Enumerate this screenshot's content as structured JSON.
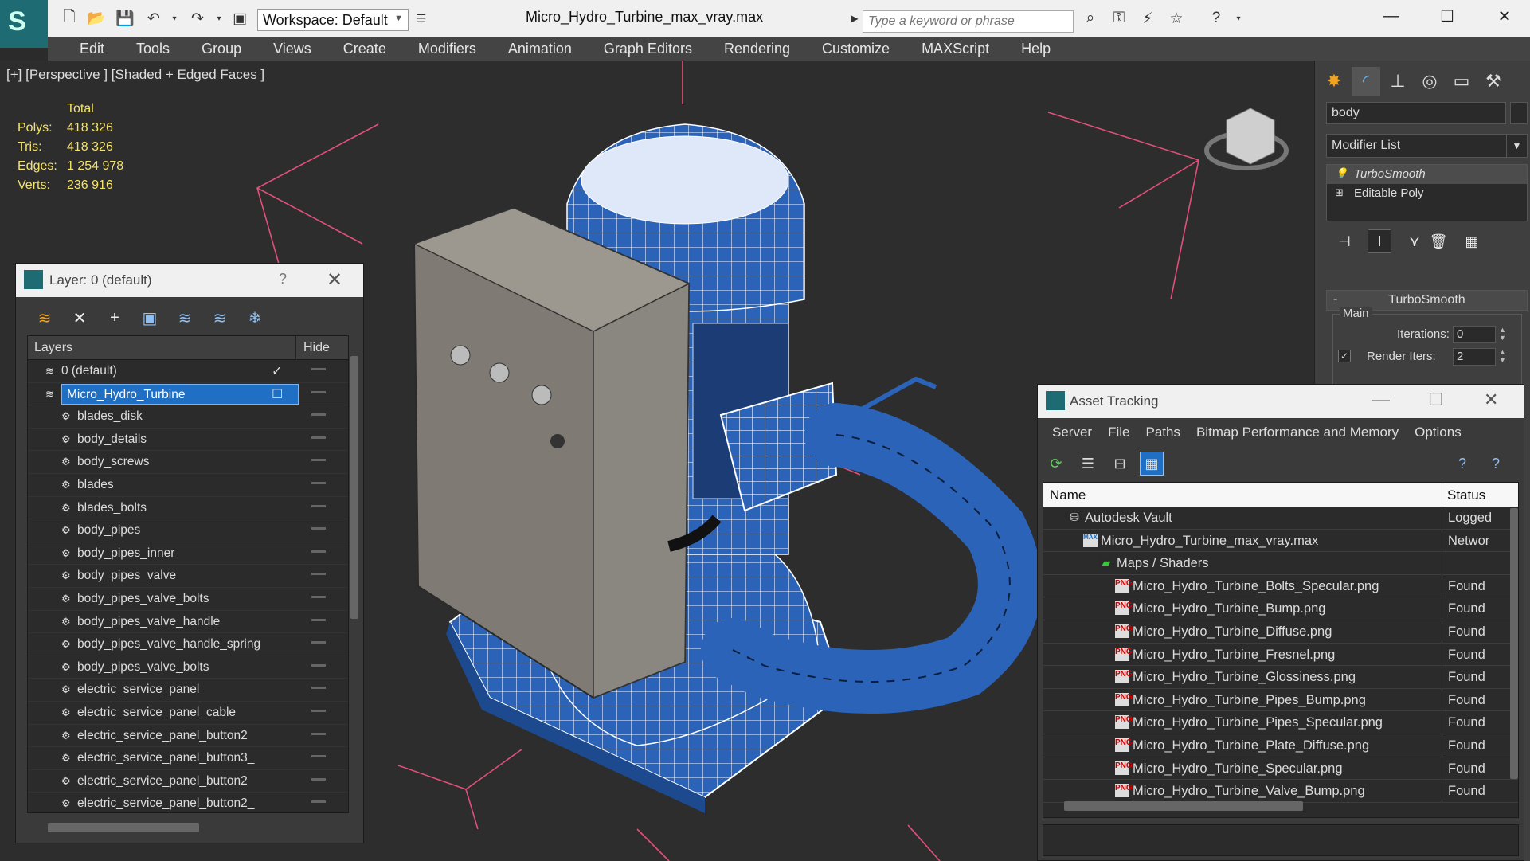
{
  "app": {
    "title": "Micro_Hydro_Turbine_max_vray.max",
    "workspace_label": "Workspace: Default",
    "search_placeholder": "Type a keyword or phrase"
  },
  "menu": [
    "Edit",
    "Tools",
    "Group",
    "Views",
    "Create",
    "Modifiers",
    "Animation",
    "Graph Editors",
    "Rendering",
    "Customize",
    "MAXScript",
    "Help"
  ],
  "viewport": {
    "label": "[+] [Perspective ] [Shaded + Edged Faces ]",
    "stats": {
      "header": "Total",
      "rows": [
        {
          "k": "Polys:",
          "v": "418 326"
        },
        {
          "k": "Tris:",
          "v": "418 326"
        },
        {
          "k": "Edges:",
          "v": "1 254 978"
        },
        {
          "k": "Verts:",
          "v": "236 916"
        }
      ]
    }
  },
  "command_panel": {
    "object_name": "body",
    "modifier_list": "Modifier List",
    "stack": [
      "TurboSmooth",
      "Editable Poly"
    ],
    "rollout_title": "TurboSmooth",
    "group_label": "Main",
    "iterations_label": "Iterations:",
    "iterations": "0",
    "render_iters_label": "Render Iters:",
    "render_iters": "2"
  },
  "layer_dialog": {
    "title": "Layer: 0 (default)",
    "help": "?",
    "col_layers": "Layers",
    "col_hide": "Hide",
    "rows": [
      {
        "name": "0 (default)",
        "level": 0,
        "type": "layer",
        "check": "✓"
      },
      {
        "name": "Micro_Hydro_Turbine",
        "level": 0,
        "type": "layer",
        "selected": true
      },
      {
        "name": "blades_disk",
        "level": 1,
        "type": "object"
      },
      {
        "name": "body_details",
        "level": 1,
        "type": "object"
      },
      {
        "name": "body_screws",
        "level": 1,
        "type": "object"
      },
      {
        "name": "blades",
        "level": 1,
        "type": "object"
      },
      {
        "name": "blades_bolts",
        "level": 1,
        "type": "object"
      },
      {
        "name": "body_pipes",
        "level": 1,
        "type": "object"
      },
      {
        "name": "body_pipes_inner",
        "level": 1,
        "type": "object"
      },
      {
        "name": "body_pipes_valve",
        "level": 1,
        "type": "object"
      },
      {
        "name": "body_pipes_valve_bolts",
        "level": 1,
        "type": "object"
      },
      {
        "name": "body_pipes_valve_handle",
        "level": 1,
        "type": "object"
      },
      {
        "name": "body_pipes_valve_handle_spring",
        "level": 1,
        "type": "object"
      },
      {
        "name": "body_pipes_valve_bolts",
        "level": 1,
        "type": "object"
      },
      {
        "name": "electric_service_panel",
        "level": 1,
        "type": "object"
      },
      {
        "name": "electric_service_panel_cable",
        "level": 1,
        "type": "object"
      },
      {
        "name": "electric_service_panel_button2",
        "level": 1,
        "type": "object"
      },
      {
        "name": "electric_service_panel_button3_",
        "level": 1,
        "type": "object"
      },
      {
        "name": "electric_service_panel_button2",
        "level": 1,
        "type": "object"
      },
      {
        "name": "electric_service_panel_button2_",
        "level": 1,
        "type": "object"
      }
    ]
  },
  "asset_dialog": {
    "title": "Asset Tracking",
    "menu": [
      "Server",
      "File",
      "Paths",
      "Bitmap Performance and Memory",
      "Options"
    ],
    "col_name": "Name",
    "col_status": "Status",
    "rows": [
      {
        "name": "Autodesk Vault",
        "level": 0,
        "status": "Logged",
        "icon": "vault-icon"
      },
      {
        "name": "Micro_Hydro_Turbine_max_vray.max",
        "level": 1,
        "status": "Networ",
        "icon": "max-file-icon"
      },
      {
        "name": "Maps / Shaders",
        "level": 2,
        "status": "",
        "icon": "maps-folder-icon"
      },
      {
        "name": "Micro_Hydro_Turbine_Bolts_Specular.png",
        "level": 3,
        "status": "Found",
        "icon": "png-file-icon"
      },
      {
        "name": "Micro_Hydro_Turbine_Bump.png",
        "level": 3,
        "status": "Found",
        "icon": "png-file-icon"
      },
      {
        "name": "Micro_Hydro_Turbine_Diffuse.png",
        "level": 3,
        "status": "Found",
        "icon": "png-file-icon"
      },
      {
        "name": "Micro_Hydro_Turbine_Fresnel.png",
        "level": 3,
        "status": "Found",
        "icon": "png-file-icon"
      },
      {
        "name": "Micro_Hydro_Turbine_Glossiness.png",
        "level": 3,
        "status": "Found",
        "icon": "png-file-icon"
      },
      {
        "name": "Micro_Hydro_Turbine_Pipes_Bump.png",
        "level": 3,
        "status": "Found",
        "icon": "png-file-icon"
      },
      {
        "name": "Micro_Hydro_Turbine_Pipes_Specular.png",
        "level": 3,
        "status": "Found",
        "icon": "png-file-icon"
      },
      {
        "name": "Micro_Hydro_Turbine_Plate_Diffuse.png",
        "level": 3,
        "status": "Found",
        "icon": "png-file-icon"
      },
      {
        "name": "Micro_Hydro_Turbine_Specular.png",
        "level": 3,
        "status": "Found",
        "icon": "png-file-icon"
      },
      {
        "name": "Micro_Hydro_Turbine_Valve_Bump.png",
        "level": 3,
        "status": "Found",
        "icon": "png-file-icon"
      }
    ]
  },
  "colors": {
    "accent": "#1f6fc4",
    "model_blue": "#2a63b8",
    "stats_yellow": "#f3e36b",
    "gizmo_pink": "#e0507a"
  }
}
